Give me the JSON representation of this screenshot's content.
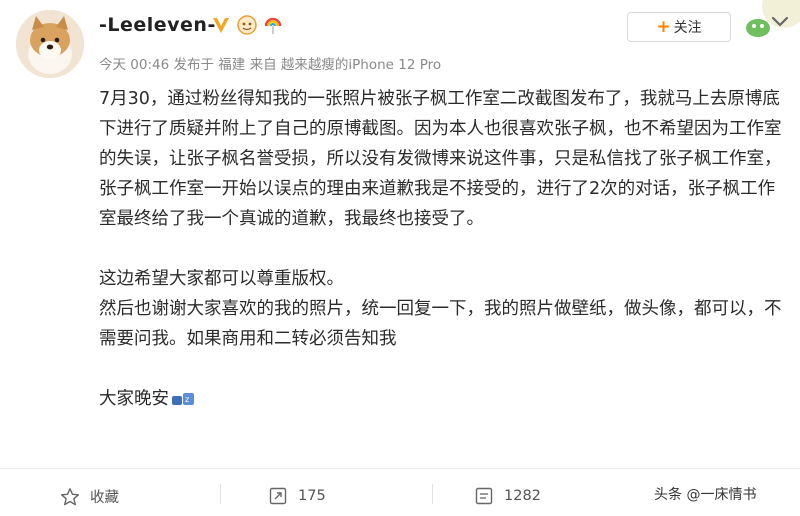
{
  "user": {
    "name": "-Leeleven-"
  },
  "follow": {
    "plus": "+",
    "label": "关注"
  },
  "meta": {
    "time": "今天 00:46",
    "location": "发布于 福建",
    "source": "来自 越来越瘦的iPhone 12 Pro"
  },
  "post": {
    "paragraphs": [
      "7月30，通过粉丝得知我的一张照片被张子枫工作室二改截图发布了，我就马上去原博底下进行了质疑并附上了自己的原博截图。因为本人也很喜欢张子枫，也不希望因为工作室的失误，让张子枫名誉受损，所以没有发微博来说这件事，只是私信找了张子枫工作室，张子枫工作室一开始以误点的理由来道歉我是不接受的，进行了2次的对话，张子枫工作室最终给了我一个真诚的道歉，我最终也接受了。",
      "这边希望大家都可以尊重版权。",
      "然后也谢谢大家喜欢的我的照片，统一回复一下，我的照片做壁纸，做头像，都可以，不需要问我。如果商用和二转必须告知我",
      "大家晚安"
    ]
  },
  "actions": {
    "favorite": "收藏",
    "repost": "175",
    "comment": "1282"
  },
  "watermark": "头条 @一床情书",
  "icons": {
    "verified": "verified-v-icon",
    "emoji": "sleeping-emoji-icon"
  },
  "colors": {
    "accent": "#ff8200",
    "meta": "#8a8a8a",
    "verified": "#f5a623"
  }
}
